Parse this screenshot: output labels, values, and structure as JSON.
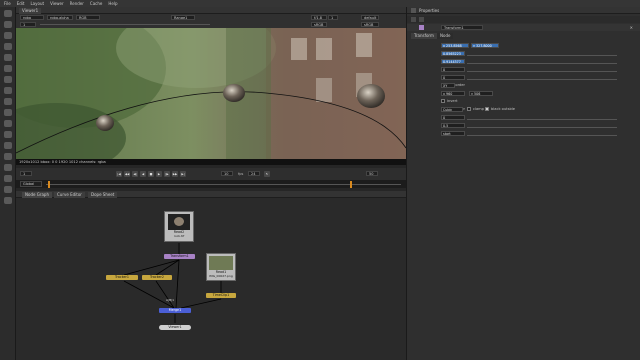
{
  "menu": [
    "File",
    "Edit",
    "Layout",
    "Viewer",
    "Render",
    "Cache",
    "Help"
  ],
  "viewer": {
    "tab": "Viewer1",
    "channels": "rgba",
    "layer": "rgba.alpha",
    "colorspace": "RGB",
    "input": "Range1",
    "zoom": "f/1.8",
    "frame_a": "1",
    "gain": "1",
    "lut": "sRGB",
    "format_a": "default",
    "format_b": "sRGB",
    "status": "1920x1012 bbox: 0 0 1920 1012 channels: rgba"
  },
  "transport": {
    "frame": "1",
    "playback": "Global",
    "fps_label": "fps",
    "fps": "24",
    "range_end": "50",
    "step": "10"
  },
  "graph_tabs": [
    "Node Graph",
    "Curve Editor",
    "Dope Sheet"
  ],
  "nodes": {
    "read2": "Read2",
    "read2_file": "rock.tif",
    "transform": "Transform1",
    "tracker1": "Tracker1",
    "tracker2": "Tracker2",
    "read1": "Read1",
    "read1_file": "IMG_00027.png",
    "timeclip": "TimeClip1",
    "merge": "Merge1",
    "merge_label": "A|B|1",
    "viewer": "Viewer1"
  },
  "properties": {
    "title": "Properties",
    "node_name": "Transform1",
    "tabs": [
      "Transform",
      "Node"
    ],
    "rows": [
      {
        "label": "translate",
        "a": "x 253.8568",
        "b": "y 327.8000"
      },
      {
        "label": "rotate",
        "a": "0.8565223",
        "b": ""
      },
      {
        "label": "scale",
        "a": "0.9144377",
        "b": ""
      },
      {
        "label": "skew X",
        "a": "0",
        "b": ""
      },
      {
        "label": "skew Y",
        "a": "0",
        "b": ""
      },
      {
        "label": "skew order",
        "a": "XY",
        "b": ""
      },
      {
        "label": "center",
        "a": "x 960",
        "b": "y 506"
      }
    ],
    "invert": "invert",
    "filter_label": "filter",
    "filter": "Cubic",
    "clamp": "clamp",
    "black_outside": "black outside",
    "motionblur_label": "motionblur",
    "motionblur": "0",
    "shutter_label": "shutter",
    "shutter": "0.5",
    "shutter_offset_label": "shutter offset",
    "shutter_offset": "start"
  }
}
